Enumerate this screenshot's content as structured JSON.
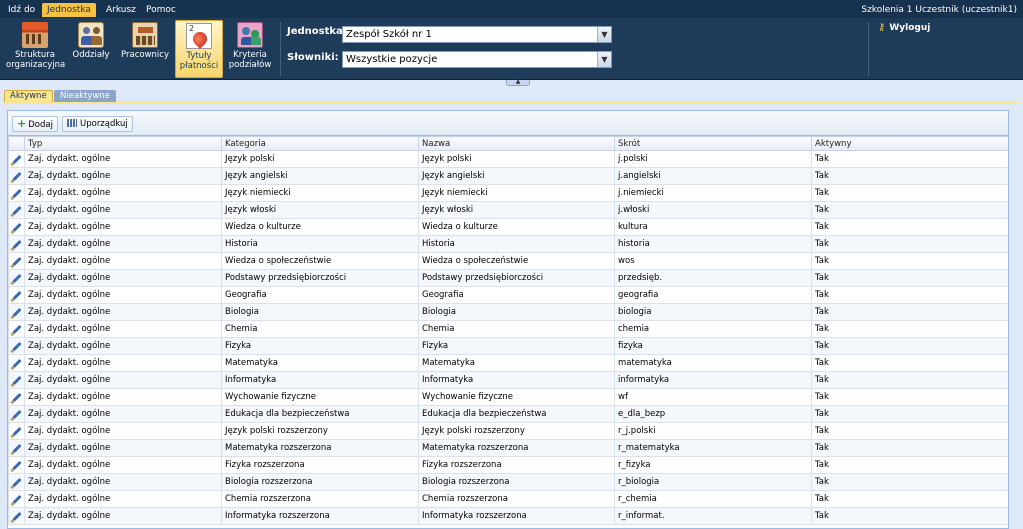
{
  "menubar": {
    "items": [
      "Idź do",
      "Jednostka",
      "Arkusz",
      "Pomoc"
    ],
    "active_index": 1,
    "user": "Szkolenia 1 Uczestnik (uczestnik1)"
  },
  "ribbon": {
    "buttons": [
      {
        "label": "Struktura organizacyjna",
        "icon": "building-icon"
      },
      {
        "label": "Oddziały",
        "icon": "class-group-icon"
      },
      {
        "label": "Pracownicy",
        "icon": "staff-icon"
      },
      {
        "label": "Tytuły płatności",
        "icon": "payment-title-icon",
        "active": true
      },
      {
        "label": "Kryteria podziałów",
        "icon": "criteria-icon"
      }
    ],
    "unit_label": "Jednostka:",
    "unit_value": "Zespół Szkół nr 1",
    "dict_label": "Słowniki:",
    "dict_value": "Wszystkie pozycje",
    "logout": "Wyloguj"
  },
  "tabs": {
    "active": "Aktywne",
    "inactive": "Nieaktywne"
  },
  "toolbar": {
    "add": "Dodaj",
    "sort": "Uporządkuj"
  },
  "grid": {
    "columns": [
      "Typ",
      "Kategoria",
      "Nazwa",
      "Skrót",
      "Aktywny"
    ],
    "rows": [
      [
        "Zaj. dydakt. ogólne",
        "Język polski",
        "Język polski",
        "j.polski",
        "Tak"
      ],
      [
        "Zaj. dydakt. ogólne",
        "Język angielski",
        "Język angielski",
        "j.angielski",
        "Tak"
      ],
      [
        "Zaj. dydakt. ogólne",
        "Język niemiecki",
        "Język niemiecki",
        "j.niemiecki",
        "Tak"
      ],
      [
        "Zaj. dydakt. ogólne",
        "Język włoski",
        "Język włoski",
        "j.włoski",
        "Tak"
      ],
      [
        "Zaj. dydakt. ogólne",
        "Wiedza o kulturze",
        "Wiedza o kulturze",
        "kultura",
        "Tak"
      ],
      [
        "Zaj. dydakt. ogólne",
        "Historia",
        "Historia",
        "historia",
        "Tak"
      ],
      [
        "Zaj. dydakt. ogólne",
        "Wiedza o społeczeństwie",
        "Wiedza o społeczeństwie",
        "wos",
        "Tak"
      ],
      [
        "Zaj. dydakt. ogólne",
        "Podstawy przedsiębiorczości",
        "Podstawy przedsiębiorczości",
        "przedsięb.",
        "Tak"
      ],
      [
        "Zaj. dydakt. ogólne",
        "Geografia",
        "Geografia",
        "geografia",
        "Tak"
      ],
      [
        "Zaj. dydakt. ogólne",
        "Biologia",
        "Biologia",
        "biologia",
        "Tak"
      ],
      [
        "Zaj. dydakt. ogólne",
        "Chemia",
        "Chemia",
        "chemia",
        "Tak"
      ],
      [
        "Zaj. dydakt. ogólne",
        "Fizyka",
        "Fizyka",
        "fizyka",
        "Tak"
      ],
      [
        "Zaj. dydakt. ogólne",
        "Matematyka",
        "Matematyka",
        "matematyka",
        "Tak"
      ],
      [
        "Zaj. dydakt. ogólne",
        "Informatyka",
        "Informatyka",
        "informatyka",
        "Tak"
      ],
      [
        "Zaj. dydakt. ogólne",
        "Wychowanie fizyczne",
        "Wychowanie fizyczne",
        "wf",
        "Tak"
      ],
      [
        "Zaj. dydakt. ogólne",
        "Edukacja dla bezpieczeństwa",
        "Edukacja dla bezpieczeństwa",
        "e_dla_bezp",
        "Tak"
      ],
      [
        "Zaj. dydakt. ogólne",
        "Język polski rozszerzony",
        "Język polski rozszerzony",
        "r_j.polski",
        "Tak"
      ],
      [
        "Zaj. dydakt. ogólne",
        "Matematyka rozszerzona",
        "Matematyka rozszerzona",
        "r_matematyka",
        "Tak"
      ],
      [
        "Zaj. dydakt. ogólne",
        "Fizyka rozszerzona",
        "Fizyka rozszerzona",
        "r_fizyka",
        "Tak"
      ],
      [
        "Zaj. dydakt. ogólne",
        "Biologia rozszerzona",
        "Biologia rozszerzona",
        "r_biologia",
        "Tak"
      ],
      [
        "Zaj. dydakt. ogólne",
        "Chemia rozszerzona",
        "Chemia rozszerzona",
        "r_chemia",
        "Tak"
      ],
      [
        "Zaj. dydakt. ogólne",
        "Informatyka rozszerzona",
        "Informatyka rozszerzona",
        "r_informat.",
        "Tak"
      ]
    ]
  }
}
